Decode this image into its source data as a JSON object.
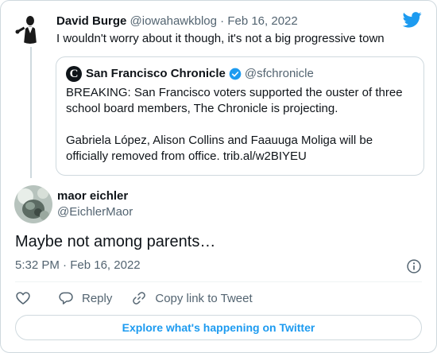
{
  "parent_tweet": {
    "author_name": "David Burge",
    "author_handle": "@iowahawkblog",
    "separator": "·",
    "date": "Feb 16, 2022",
    "text": "I wouldn't worry about it though, it's not a big progressive town"
  },
  "quoted_tweet": {
    "logo_letter": "C",
    "author_name": "San Francisco Chronicle",
    "author_handle": "@sfchronicle",
    "paragraph_1": "BREAKING: San Francisco voters supported the ouster of three school board members, The Chronicle is projecting.",
    "paragraph_2": "Gabriela López, Alison Collins and Faauuga Moliga will be officially removed from office. trib.al/w2BIYEU"
  },
  "main_tweet": {
    "author_name": "maor eichler",
    "author_handle": "@EichlerMaor",
    "text": "Maybe not among parents…",
    "time": "5:32 PM",
    "separator": "·",
    "date": "Feb 16, 2022"
  },
  "actions": {
    "reply_label": "Reply",
    "copy_label": "Copy link to Tweet"
  },
  "explore_label": "Explore what's happening on Twitter",
  "colors": {
    "brand_blue": "#1d9bf0",
    "muted_text": "#536471",
    "border": "#cfd9de"
  },
  "icons": [
    "twitter-bird-icon",
    "verified-badge-icon",
    "info-icon",
    "heart-icon",
    "reply-icon",
    "link-icon"
  ]
}
